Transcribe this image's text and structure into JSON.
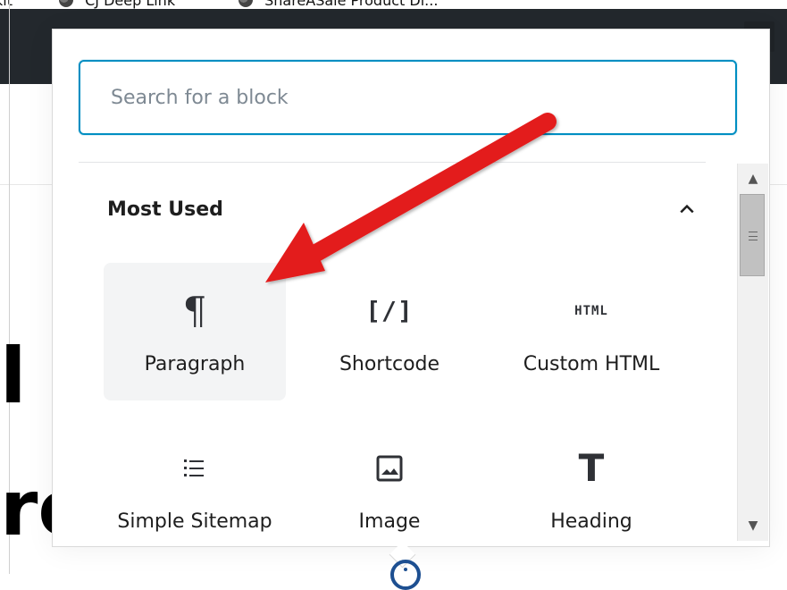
{
  "bookmarks": [
    {
      "label": "kit"
    },
    {
      "label": "CJ Deep Link"
    },
    {
      "label": "ShareASale Product Di..."
    }
  ],
  "background": {
    "partial_text_1": "l",
    "partial_text_2": "ro"
  },
  "inserter": {
    "search_placeholder": "Search for a block",
    "section_title": "Most Used",
    "blocks": [
      {
        "label": "Paragraph",
        "icon": "pilcrow-icon",
        "icon_text": "¶"
      },
      {
        "label": "Shortcode",
        "icon": "shortcode-icon",
        "icon_text": "[/]"
      },
      {
        "label": "Custom HTML",
        "icon": "html-icon",
        "icon_text": "HTML"
      },
      {
        "label": "Simple Sitemap",
        "icon": "list-icon",
        "icon_text": ""
      },
      {
        "label": "Image",
        "icon": "image-icon",
        "icon_text": ""
      },
      {
        "label": "Heading",
        "icon": "heading-icon",
        "icon_text": "T"
      }
    ]
  },
  "colors": {
    "focus_border": "#008ec2",
    "arrow": "#e31b1b",
    "selected_bg": "#f3f4f5"
  }
}
